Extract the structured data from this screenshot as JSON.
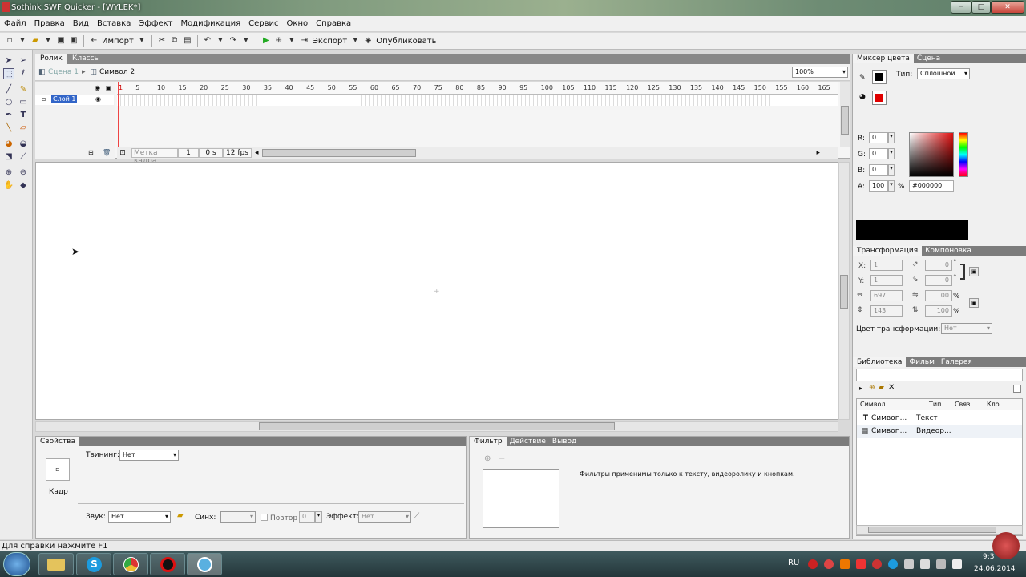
{
  "window": {
    "title": "Sothink SWF Quicker - [WYLEK*]",
    "min": "─",
    "max": "□",
    "close": "✕"
  },
  "menu": [
    "Файл",
    "Правка",
    "Вид",
    "Вставка",
    "Эффект",
    "Модификация",
    "Сервис",
    "Окно",
    "Справка"
  ],
  "toolbar": {
    "import": "Импорт",
    "export": "Экспорт",
    "publish": "Опубликовать"
  },
  "doc": {
    "tabs": [
      "Ролик",
      "Классы"
    ],
    "scene": "Сцена 1",
    "symbol": "Символ 2",
    "zoom": "100%"
  },
  "timeline": {
    "layer": "Слой 1",
    "ticks": [
      "1",
      "5",
      "10",
      "15",
      "20",
      "25",
      "30",
      "35",
      "40",
      "45",
      "50",
      "55",
      "60",
      "65",
      "70",
      "75",
      "80",
      "85",
      "90",
      "95",
      "100",
      "105",
      "110",
      "115",
      "120",
      "125",
      "130",
      "135",
      "140",
      "145",
      "150",
      "155",
      "160",
      "165"
    ],
    "frame_label": "Метка кадра",
    "frame": "1",
    "time": "0 s",
    "fps": "12 fps"
  },
  "properties": {
    "tab": "Свойства",
    "kadr": "Кадр",
    "tween_label": "Твининг:",
    "tween_value": "Нет",
    "sound_label": "Звук:",
    "sound_value": "Нет",
    "sync_label": "Синх:",
    "repeat_label": "Повтор",
    "repeat_value": "0",
    "effect_label": "Эффект:",
    "effect_value": "Нет"
  },
  "filter": {
    "tabs": [
      "Фильтр",
      "Действие",
      "Вывод"
    ],
    "message": "Фильтры применимы только к тексту, видеоролику и кнопкам."
  },
  "color_mixer": {
    "tabs": [
      "Миксер цвета",
      "Сцена"
    ],
    "type_label": "Тип:",
    "type_value": "Сплошной",
    "r_label": "R:",
    "r": "0",
    "g_label": "G:",
    "g": "0",
    "b_label": "B:",
    "b": "0",
    "a_label": "A:",
    "a": "100",
    "percent": "%",
    "hex": "#000000",
    "stroke_color": "#000000",
    "fill_color": "#e00000"
  },
  "transform": {
    "tabs": [
      "Трансформация",
      "Компоновка"
    ],
    "x_label": "X:",
    "x": "1",
    "y_label": "Y:",
    "y": "1",
    "skew_h": "0",
    "skew_v": "0",
    "width": "697",
    "height": "143",
    "scale_w": "100",
    "scale_h": "100",
    "percent": "%",
    "degree": "°",
    "color_label": "Цвет трансформации:",
    "color_value": "Нет"
  },
  "library": {
    "tabs": [
      "Библиотека",
      "Фильм",
      "Галерея"
    ],
    "columns": [
      "Символ",
      "Тип",
      "Связ...",
      "Кло"
    ],
    "rows": [
      {
        "name": "Симвоп...",
        "type": "Текст"
      },
      {
        "name": "Симвоп...",
        "type": "Видеор..."
      }
    ]
  },
  "status": "Для справки нажмите F1",
  "tray": {
    "lang": "RU",
    "time": "9:3",
    "date": "24.06.2014"
  }
}
